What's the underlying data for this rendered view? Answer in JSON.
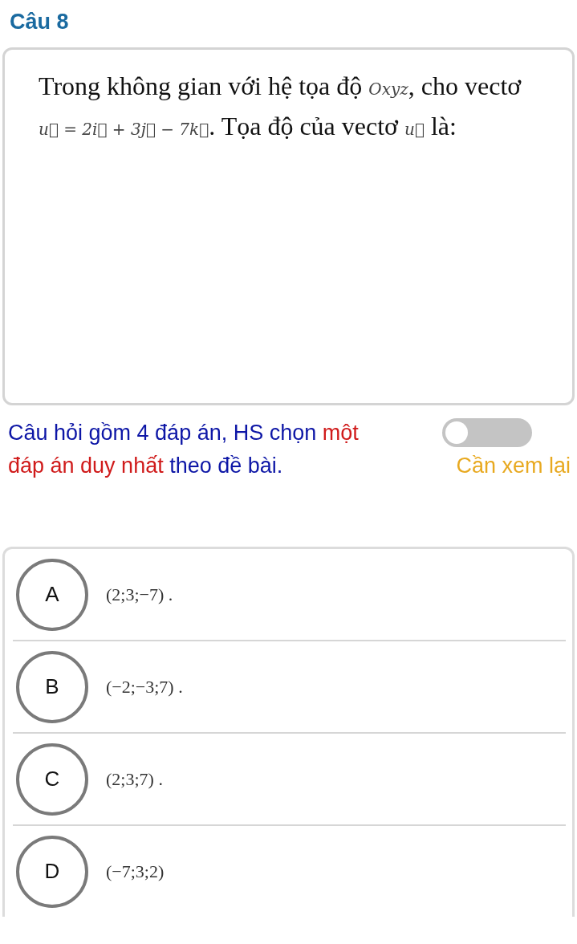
{
  "title": "Câu 8",
  "question": [
    {
      "kind": "text",
      "text": "Trong không gian với hệ tọa độ "
    },
    {
      "kind": "math",
      "text": "Oxyz"
    },
    {
      "kind": "text",
      "text": ", cho vectơ "
    },
    {
      "kind": "math",
      "text": "u⃗ = 2i⃗ + 3j⃗ − 7k⃗"
    },
    {
      "kind": "text",
      "text": ". Tọa độ của vectơ "
    },
    {
      "kind": "math",
      "text": "u⃗"
    },
    {
      "kind": "text",
      "text": " là:"
    }
  ],
  "instruction": [
    {
      "kind": "normal",
      "text": "Câu hỏi gồm 4 đáp án, HS chọn "
    },
    {
      "kind": "emphasis",
      "text": "một đáp án duy nhất"
    },
    {
      "kind": "normal",
      "text": " theo đề bài."
    }
  ],
  "review_toggle": {
    "on": false,
    "label": "Cần xem lại"
  },
  "options": [
    {
      "letter": "A",
      "text": "(2;3;−7) .",
      "selected": false
    },
    {
      "letter": "B",
      "text": "(−2;−3;7) .",
      "selected": false
    },
    {
      "letter": "C",
      "text": "(2;3;7) .",
      "selected": false
    },
    {
      "letter": "D",
      "text": "(−7;3;2)",
      "selected": false
    }
  ]
}
